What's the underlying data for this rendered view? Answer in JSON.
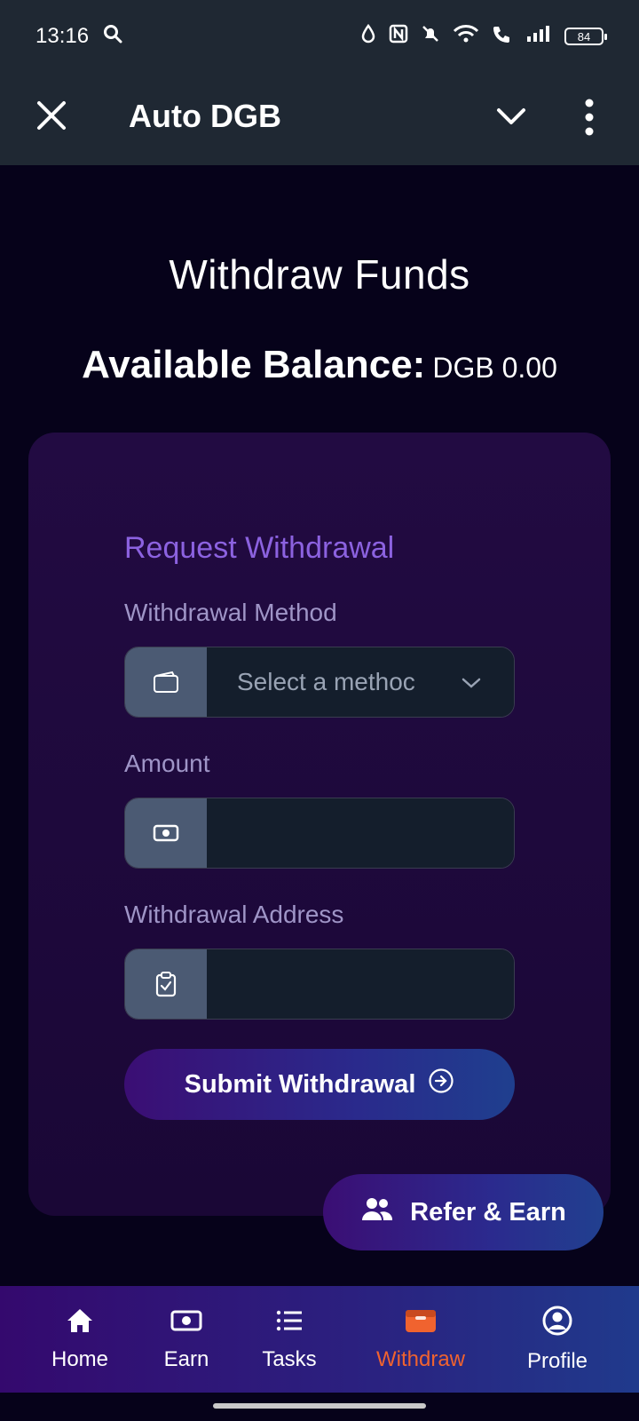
{
  "status_bar": {
    "time": "13:16",
    "battery": "84"
  },
  "app_bar": {
    "title": "Auto DGB"
  },
  "page": {
    "title": "Withdraw Funds",
    "balance_label": "Available Balance:",
    "balance_value": "DGB 0.00"
  },
  "form": {
    "title": "Request Withdrawal",
    "method_label": "Withdrawal Method",
    "method_placeholder": "Select a methoc",
    "amount_label": "Amount",
    "amount_value": "",
    "address_label": "Withdrawal Address",
    "address_value": "",
    "submit_label": "Submit Withdrawal"
  },
  "refer_button": {
    "label": "Refer & Earn"
  },
  "bottom_nav": {
    "items": [
      {
        "label": "Home",
        "icon": "home-icon"
      },
      {
        "label": "Earn",
        "icon": "cash-icon"
      },
      {
        "label": "Tasks",
        "icon": "list-icon"
      },
      {
        "label": "Withdraw",
        "icon": "wallet-icon",
        "active": true
      },
      {
        "label": "Profile",
        "icon": "user-circle-icon"
      }
    ]
  },
  "colors": {
    "accent_active": "#f0632f",
    "card_title": "#8c62e0",
    "label": "#9f95c7"
  }
}
